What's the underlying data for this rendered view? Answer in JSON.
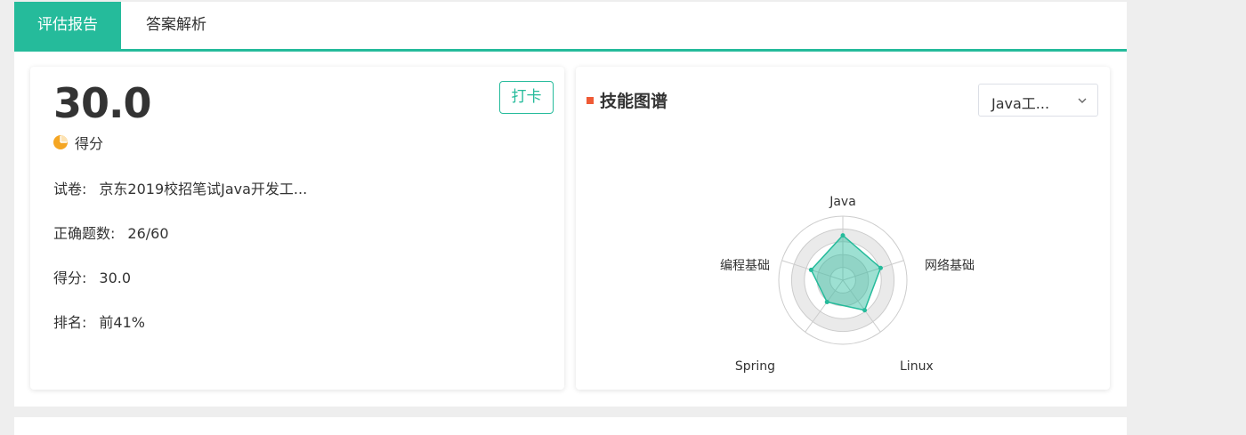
{
  "tabs": [
    {
      "label": "评估报告",
      "active": true
    },
    {
      "label": "答案解析",
      "active": false
    }
  ],
  "score": {
    "value": "30.0",
    "label": "得分",
    "checkin_label": "打卡"
  },
  "info": [
    {
      "key": "试卷:",
      "value": "京东2019校招笔试Java开发工..."
    },
    {
      "key": "正确题数:",
      "value": "26/60"
    },
    {
      "key": "得分:",
      "value": "30.0"
    },
    {
      "key": "排名:",
      "value": "前41%"
    }
  ],
  "skills": {
    "title": "技能图谱",
    "select_value": "Java工...",
    "axes": [
      "Java",
      "网络基础",
      "Linux",
      "Spring",
      "编程基础"
    ],
    "values": [
      0.7,
      0.62,
      0.58,
      0.42,
      0.52
    ]
  },
  "colors": {
    "accent": "#25bb9b",
    "marker": "#ef5a35",
    "pie": "#f5a623"
  },
  "icons": {
    "score": "pie-chart-icon",
    "select": "chevron-down-icon"
  }
}
